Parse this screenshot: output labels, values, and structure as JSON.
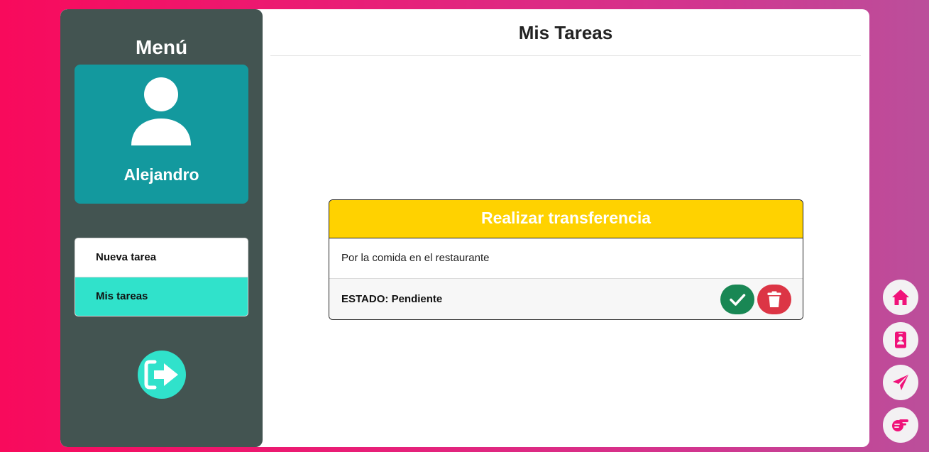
{
  "sidebar": {
    "title": "Menú",
    "user": {
      "name": "Alejandro",
      "avatar_icon": "user-icon"
    },
    "nav": [
      {
        "label": "Nueva tarea",
        "active": false
      },
      {
        "label": "Mis tareas",
        "active": true
      }
    ],
    "logout_icon": "logout-icon"
  },
  "main": {
    "title": "Mis Tareas",
    "tasks": [
      {
        "title": "Realizar transferencia",
        "description": "Por la comida en el restaurante",
        "status_label": "ESTADO:",
        "status_value": "Pendiente",
        "actions": [
          "check-icon",
          "trash-icon"
        ]
      }
    ]
  },
  "floating_nav": {
    "icons": [
      "home-icon",
      "contact-card-icon",
      "send-icon",
      "pointing-hand-icon"
    ]
  },
  "colors": {
    "background_start": "#f80a5c",
    "background_end": "#bb4f9b",
    "sidebar": "#435451",
    "profile_card": "#13999e",
    "active_nav": "#30e2cb",
    "task_header": "#ffd200",
    "complete": "#198754",
    "delete": "#dc3545",
    "float_icon": "#f0127a"
  }
}
